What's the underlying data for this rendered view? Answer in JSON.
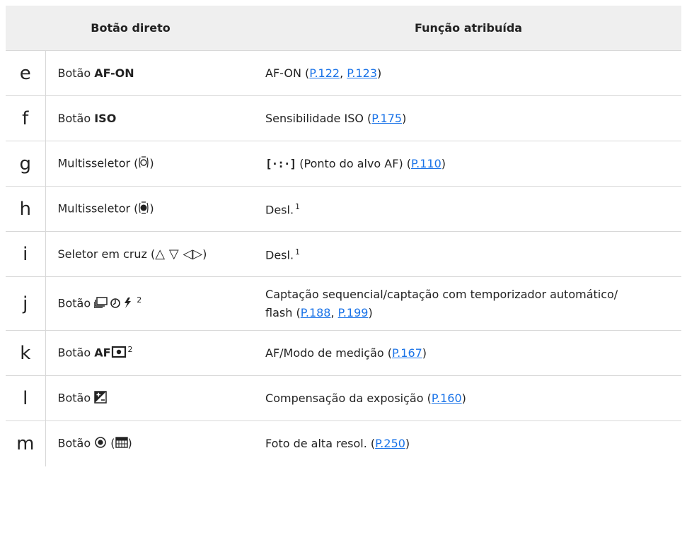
{
  "header": {
    "col_button": "Botão direto",
    "col_function": "Função atribuída"
  },
  "rows": [
    {
      "letter": "e",
      "button_prefix": "Botão ",
      "button_bold": "AF-ON",
      "func_text": "AF-ON (",
      "links": [
        "P.122",
        "P.123"
      ]
    },
    {
      "letter": "f",
      "button_prefix": "Botão ",
      "button_bold": "ISO",
      "func_text": "Sensibilidade ISO (",
      "links": [
        "P.175"
      ]
    },
    {
      "letter": "g",
      "button_prefix": "Multisseletor (",
      "button_suffix": ")",
      "button_icon": "multiselector-tilt-icon",
      "func_icon": "af-target-icon",
      "func_text": " (Ponto do alvo AF) (",
      "links": [
        "P.110"
      ]
    },
    {
      "letter": "h",
      "button_prefix": "Multisseletor (",
      "button_suffix": ")",
      "button_icon": "multiselector-press-icon",
      "func_text": "Desl.",
      "note": "1"
    },
    {
      "letter": "i",
      "button_prefix": "Seletor em cruz (",
      "button_arrows": "△ ▽ ◁▷",
      "button_suffix": ")",
      "func_text": "Desl.",
      "note": "1"
    },
    {
      "letter": "j",
      "button_prefix": "Botão ",
      "button_icon": "drive-selftimer-flash-icon",
      "note": "2",
      "func_line1": "Captação sequencial/captação com temporizador automático/",
      "func_line2": "flash (",
      "links": [
        "P.188",
        "P.199"
      ]
    },
    {
      "letter": "k",
      "button_prefix": "Botão ",
      "button_bold": "AF",
      "button_icon": "metering-icon",
      "note": "2",
      "func_text": "AF/Modo de medição (",
      "links": [
        "P.167"
      ]
    },
    {
      "letter": "l",
      "button_prefix": "Botão ",
      "button_icon": "exposure-compensation-icon",
      "func_text": "Compensação da exposição (",
      "links": [
        "P.160"
      ]
    },
    {
      "letter": "m",
      "button_prefix": "Botão ",
      "button_icon": "high-res-icon",
      "button_icon2": "grid-icon",
      "func_text": "Foto de alta resol. (",
      "links": [
        "P.250"
      ]
    }
  ],
  "glyphs": {
    "af_target": "[·:·]",
    "comma": ", ",
    "close": ")"
  },
  "colors": {
    "link": "#1a73e8",
    "header_bg": "#efefef",
    "border": "#d8d8d8"
  }
}
